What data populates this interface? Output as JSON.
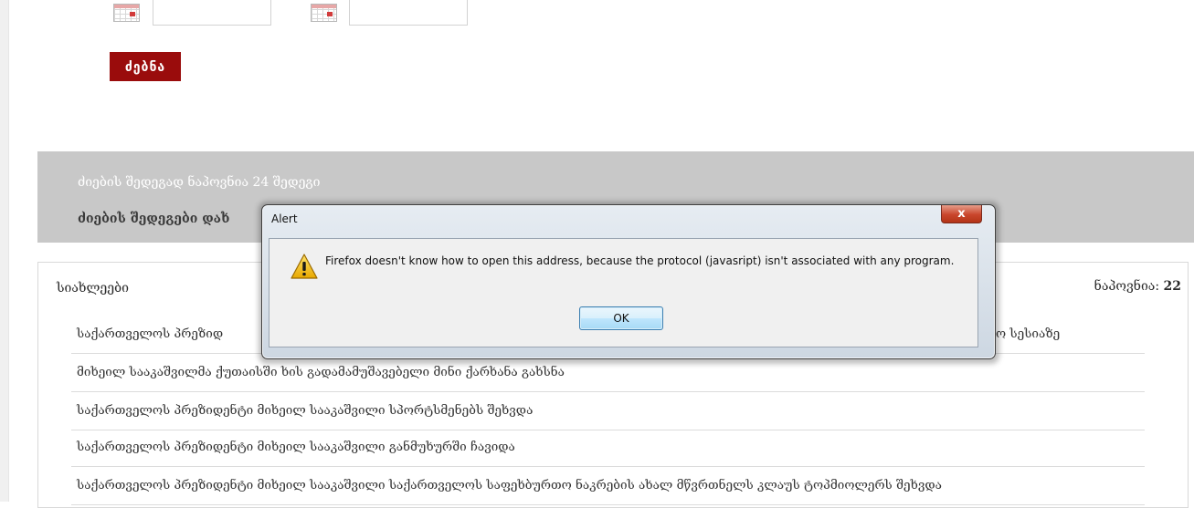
{
  "search": {
    "button_label": "ძებნა"
  },
  "results": {
    "found_text": "ძიების შედეგად ნაპოვნია 24 შედეგი",
    "sort_text": "ძიების შედეგები დახ"
  },
  "news": {
    "title": "სიახლეები",
    "found_label": "ნაპოვნია:",
    "found_count": "22",
    "items": [
      {
        "title": "საქართველოს პრეზიდ",
        "tail": "ო სესიაზე"
      },
      {
        "title": "მიხეილ სააკაშვილმა ქუთაისში ხის გადამამუშავებელი მინი ქარხანა გახსნა"
      },
      {
        "title": "საქართველოს პრეზიდენტი მიხეილ სააკაშვილი სპორტსმენებს შეხვდა"
      },
      {
        "title": "საქართველოს პრეზიდენტი მიხეილ სააკაშვილი განმუხურში ჩავიდა"
      },
      {
        "title": "საქართველოს პრეზიდენტი მიხეილ სააკაშვილი საქართველოს საფეხბურთო ნაკრების ახალ მწვრთნელს კლაუს ტოპმიოლერს შეხვდა"
      }
    ]
  },
  "alert": {
    "title": "Alert",
    "close_glyph": "x",
    "message": "Firefox doesn't know how to open this address, because the protocol (javasript) isn't associated with any program.",
    "ok_label": "OK",
    "icon": "warning-icon"
  },
  "colors": {
    "search_button": "#9a0c0c",
    "results_band": "#c8c8c8",
    "close_button": "#c9462c"
  }
}
